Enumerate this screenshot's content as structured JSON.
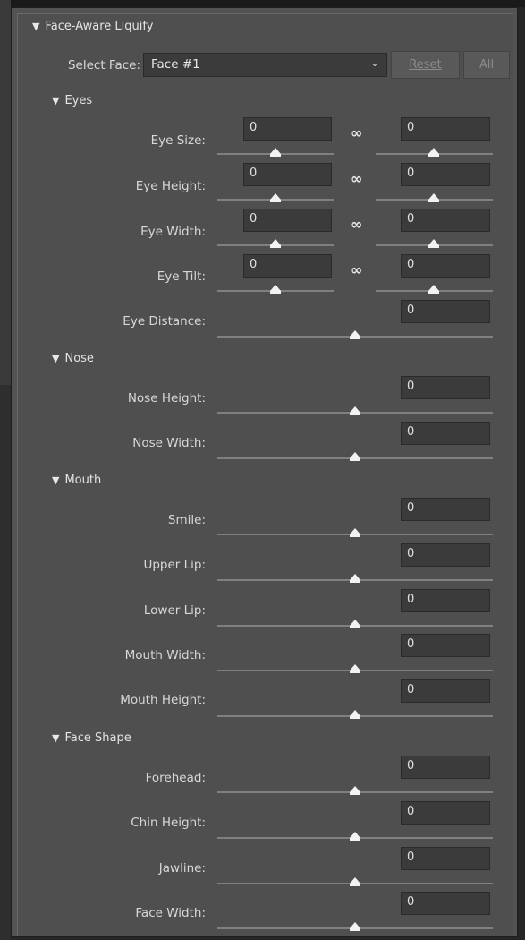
{
  "panel": {
    "title": "Face-Aware Liquify",
    "select_face_label": "Select Face:",
    "select_face_value": "Face #1",
    "reset_label": "Reset",
    "all_label": "All"
  },
  "sections": {
    "eyes": {
      "title": "Eyes",
      "eye_size": {
        "label": "Eye Size:",
        "left": "0",
        "right": "0"
      },
      "eye_height": {
        "label": "Eye Height:",
        "left": "0",
        "right": "0"
      },
      "eye_width": {
        "label": "Eye Width:",
        "left": "0",
        "right": "0"
      },
      "eye_tilt": {
        "label": "Eye Tilt:",
        "left": "0",
        "right": "0"
      },
      "eye_distance": {
        "label": "Eye Distance:",
        "value": "0"
      }
    },
    "nose": {
      "title": "Nose",
      "nose_height": {
        "label": "Nose Height:",
        "value": "0"
      },
      "nose_width": {
        "label": "Nose Width:",
        "value": "0"
      }
    },
    "mouth": {
      "title": "Mouth",
      "smile": {
        "label": "Smile:",
        "value": "0"
      },
      "upper_lip": {
        "label": "Upper Lip:",
        "value": "0"
      },
      "lower_lip": {
        "label": "Lower Lip:",
        "value": "0"
      },
      "mouth_width": {
        "label": "Mouth Width:",
        "value": "0"
      },
      "mouth_height": {
        "label": "Mouth Height:",
        "value": "0"
      }
    },
    "face_shape": {
      "title": "Face Shape",
      "forehead": {
        "label": "Forehead:",
        "value": "0"
      },
      "chin_height": {
        "label": "Chin Height:",
        "value": "0"
      },
      "jawline": {
        "label": "Jawline:",
        "value": "0"
      },
      "face_width": {
        "label": "Face Width:",
        "value": "0"
      }
    }
  },
  "icons": {
    "collapse": "triangle-down-icon",
    "link": "chain-link-icon",
    "dropdown": "chevron-down-icon"
  }
}
